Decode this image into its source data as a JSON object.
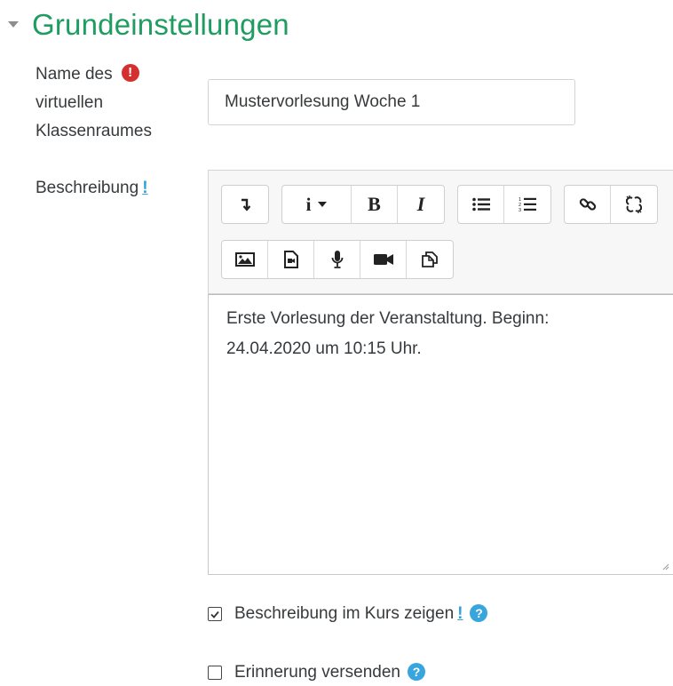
{
  "section": {
    "title": "Grundeinstellungen",
    "collapse_icon": "caret-down-icon"
  },
  "name_field": {
    "label_lines": [
      "Name des",
      "virtuellen",
      "Klassenraumes"
    ],
    "required_icon": "!",
    "value": "Mustervorlesung Woche 1"
  },
  "description": {
    "label": "Beschreibung",
    "help_mark": "!",
    "toolbar": {
      "row1": [
        {
          "name": "collapse-toolbar-button",
          "text": ""
        },
        {
          "name": "info-style-button",
          "text": "i"
        },
        {
          "name": "bold-button",
          "text": "B"
        },
        {
          "name": "italic-button",
          "text": "I"
        },
        {
          "name": "unordered-list-button",
          "text": ""
        },
        {
          "name": "ordered-list-button",
          "text": ""
        },
        {
          "name": "link-button",
          "text": ""
        },
        {
          "name": "unlink-button",
          "text": ""
        }
      ],
      "row2": [
        {
          "name": "insert-image-button",
          "text": ""
        },
        {
          "name": "insert-media-button",
          "text": ""
        },
        {
          "name": "record-audio-button",
          "text": ""
        },
        {
          "name": "record-video-button",
          "text": ""
        },
        {
          "name": "manage-files-button",
          "text": ""
        }
      ]
    },
    "content_lines": [
      "Erste Vorlesung der Veranstaltung. Beginn:",
      "24.04.2020 um 10:15 Uhr."
    ]
  },
  "show_description": {
    "label": "Beschreibung im Kurs zeigen",
    "help_mark": "!",
    "help_icon": "?",
    "checked": true
  },
  "send_reminder": {
    "label": "Erinnerung versenden",
    "help_icon": "?",
    "checked": false
  },
  "colors": {
    "section_title": "#1f9d61",
    "required": "#d43030",
    "help": "#38a6dd"
  }
}
